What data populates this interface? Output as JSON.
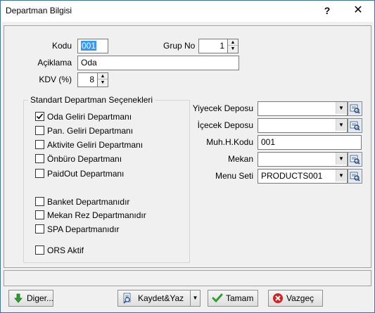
{
  "window": {
    "title": "Departman Bilgisi",
    "help_label": "?",
    "close_label": "✕"
  },
  "form": {
    "kodu_label": "Kodu",
    "kodu_value": "001",
    "grup_no_label": "Grup No",
    "grup_no_value": "1",
    "aciklama_label": "Açiklama",
    "aciklama_value": "Oda",
    "kdv_label": "KDV (%)",
    "kdv_value": "8"
  },
  "options_group": {
    "title": "Standart Departman Seçenekleri",
    "items": [
      {
        "label": "Oda Geliri Departmanı",
        "checked": true
      },
      {
        "label": "Pan. Geliri Departmanı",
        "checked": false
      },
      {
        "label": "Aktivite Geliri Departmanı",
        "checked": false
      },
      {
        "label": "Önbüro Departmanı",
        "checked": false
      },
      {
        "label": "PaidOut Departmanı",
        "checked": false
      },
      {
        "label": "Banket Departmanıdır",
        "checked": false
      },
      {
        "label": "Mekan Rez Departmanıdır",
        "checked": false
      },
      {
        "label": "SPA Departmanıdır",
        "checked": false
      },
      {
        "label": "ORS Aktif",
        "checked": false
      }
    ]
  },
  "right_fields": {
    "yiyecek_label": "Yiyecek Deposu",
    "yiyecek_value": "",
    "icecek_label": "İçecek Deposu",
    "icecek_value": "",
    "muh_label": "Muh.H.Kodu",
    "muh_value": "001",
    "mekan_label": "Mekan",
    "mekan_value": "",
    "menu_label": "Menu Seti",
    "menu_value": "PRODUCTS001"
  },
  "buttons": {
    "diger_label": "Diger...",
    "kaydet_label": "Kaydet&Yaz",
    "tamam_label": "Tamam",
    "vazgec_label": "Vazgeç"
  }
}
